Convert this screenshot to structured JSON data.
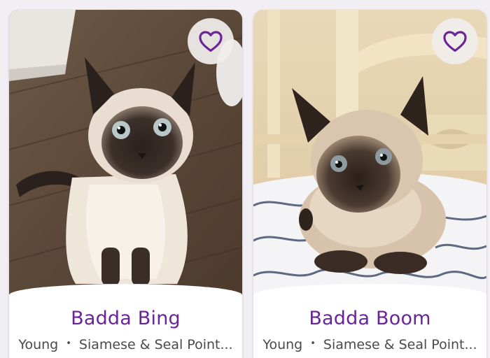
{
  "pets": [
    {
      "name": "Badda Bing",
      "age": "Young",
      "separator": "•",
      "breed": "Siamese & Seal Point...",
      "image": "siamese-cat-sitting-on-wood-floor",
      "favorite_icon": "heart-outline-icon"
    },
    {
      "name": "Badda Boom",
      "age": "Young",
      "separator": "•",
      "breed": "Siamese & Seal Point...",
      "image": "siamese-kitten-lying-on-bed",
      "favorite_icon": "heart-outline-icon"
    }
  ],
  "colors": {
    "name": "#6a2498",
    "heart": "#6a2498",
    "meta": "#4a4a4a"
  }
}
